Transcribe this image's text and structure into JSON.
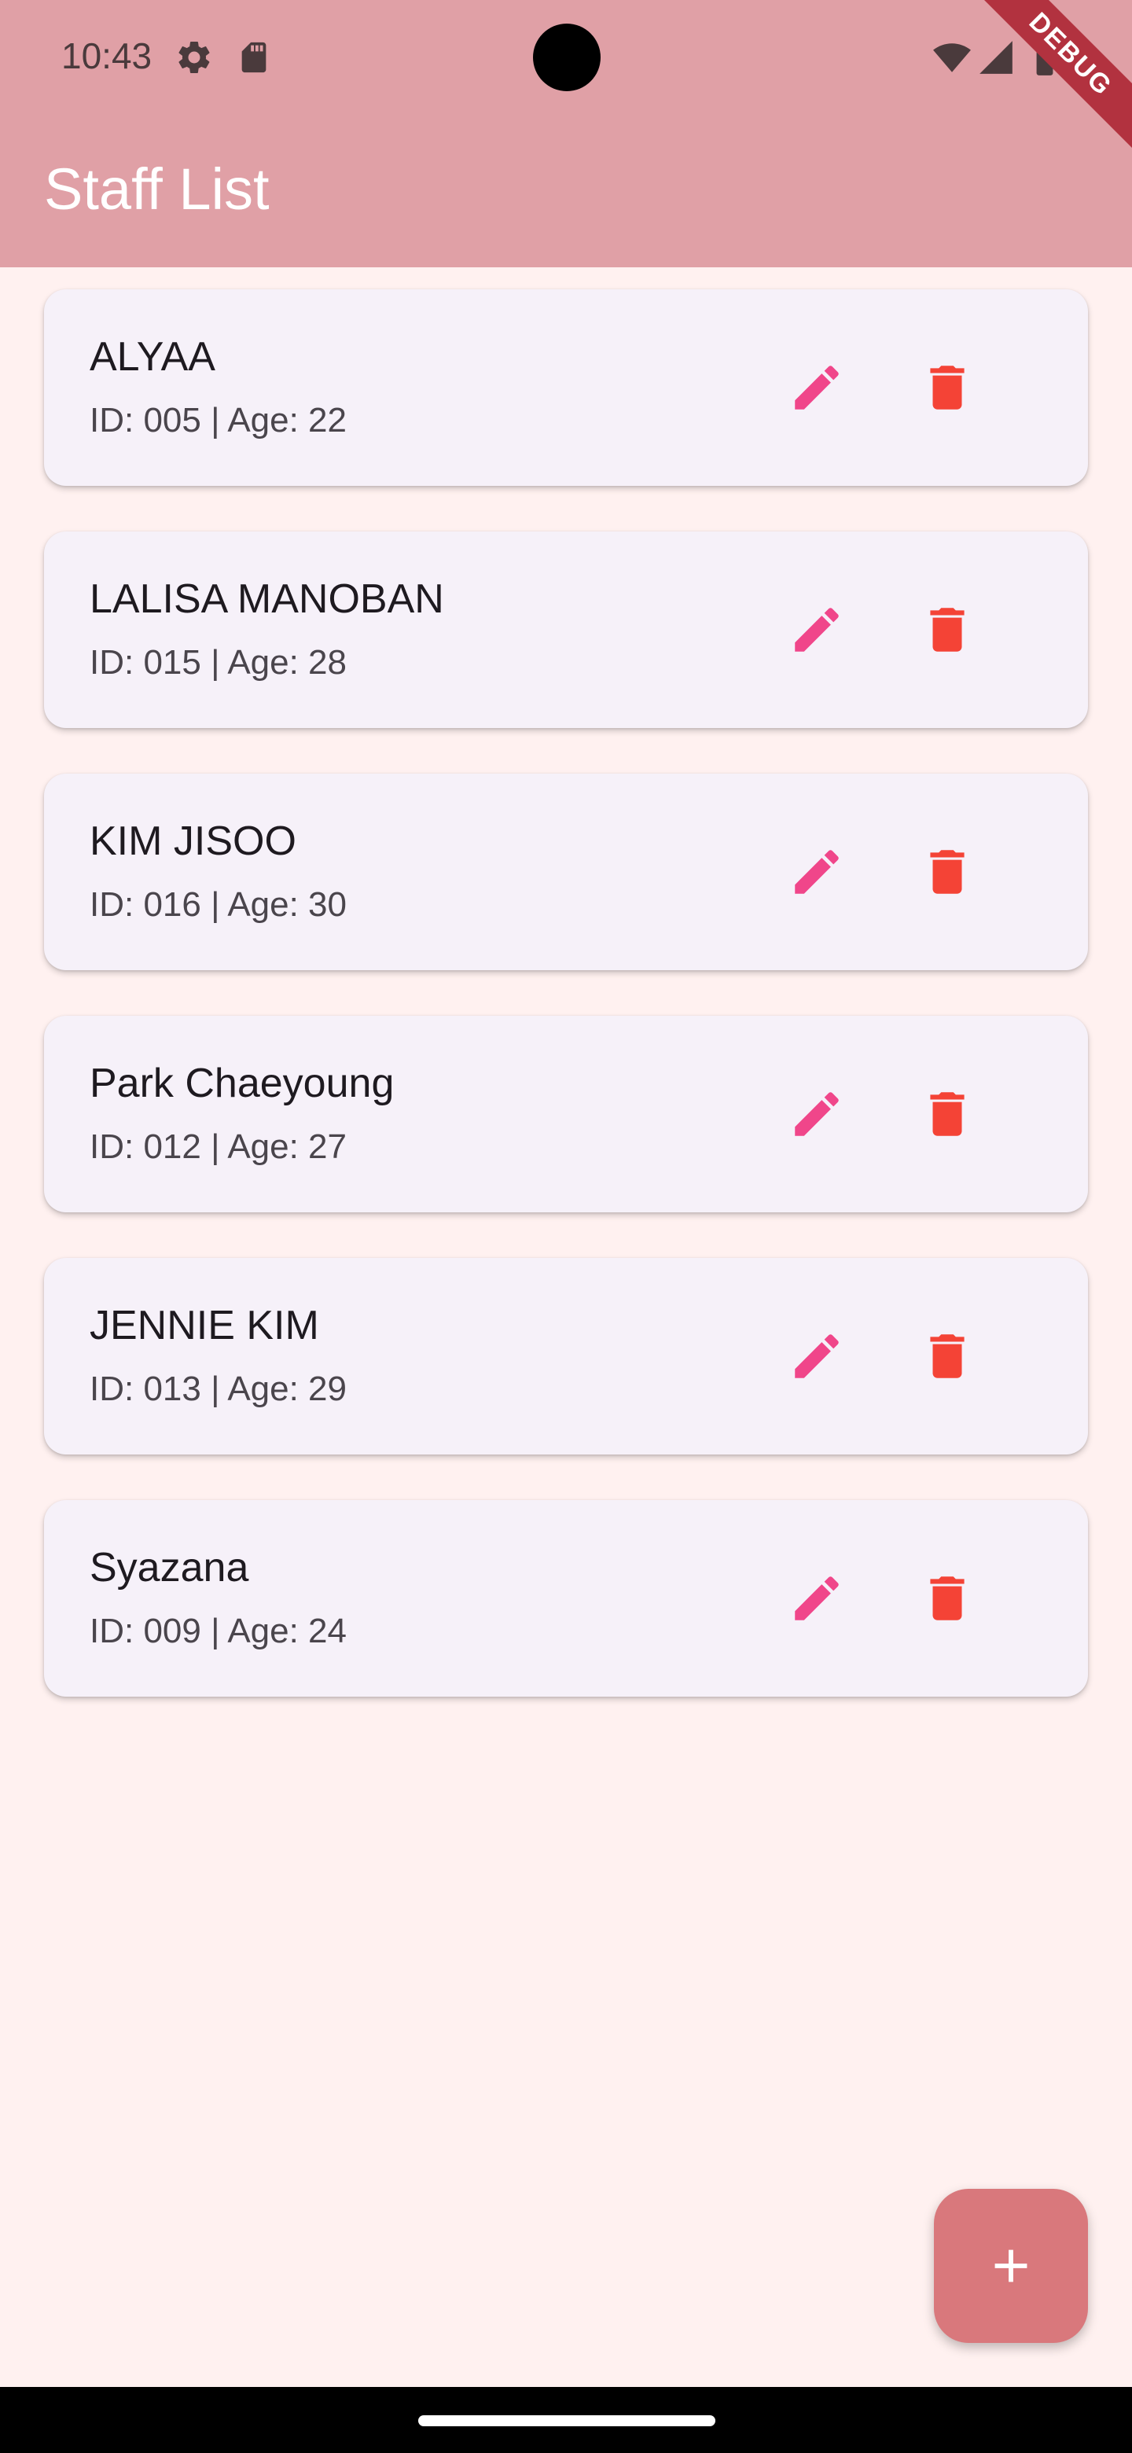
{
  "status_bar": {
    "time": "10:43"
  },
  "debug_banner": "DEBUG",
  "app_bar": {
    "title": "Staff List"
  },
  "colors": {
    "header": "#e0a0a6",
    "background": "#fff1f0",
    "card": "#f6f1f9",
    "edit_icon": "#f0468a",
    "delete_icon": "#f44336",
    "fab": "#d9787c"
  },
  "staff": [
    {
      "name": "ALYAA",
      "subtitle": "ID: 005 | Age: 22"
    },
    {
      "name": "LALISA MANOBAN",
      "subtitle": "ID: 015 | Age: 28"
    },
    {
      "name": "KIM JISOO",
      "subtitle": "ID: 016 | Age: 30"
    },
    {
      "name": "Park Chaeyoung",
      "subtitle": "ID: 012 | Age: 27"
    },
    {
      "name": "JENNIE KIM",
      "subtitle": "ID: 013 | Age: 29"
    },
    {
      "name": "Syazana",
      "subtitle": "ID: 009 | Age: 24"
    }
  ],
  "icons": {
    "settings": "gear-icon",
    "sd_card": "sd-card-icon",
    "wifi": "wifi-icon",
    "signal": "signal-icon",
    "battery": "battery-icon",
    "edit": "pencil-icon",
    "delete": "trash-icon",
    "add": "plus-icon"
  }
}
